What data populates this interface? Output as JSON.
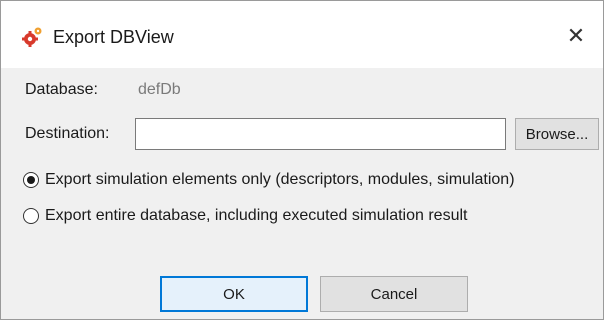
{
  "window": {
    "title": "Export DBView",
    "close_glyph": "✕",
    "app_icon": "gear-icon"
  },
  "database": {
    "label": "Database:",
    "value": "defDb"
  },
  "destination": {
    "label": "Destination:",
    "value": "",
    "placeholder": "",
    "browse_label": "Browse..."
  },
  "options": [
    {
      "label": "Export simulation elements only (descriptors, modules, simulation)",
      "selected": true
    },
    {
      "label": "Export entire database, including executed simulation result",
      "selected": false
    }
  ],
  "buttons": {
    "ok_label": "OK",
    "cancel_label": "Cancel"
  },
  "colors": {
    "accent": "#0078d7",
    "icon_red": "#d83a2c",
    "icon_orange": "#f0a030"
  }
}
